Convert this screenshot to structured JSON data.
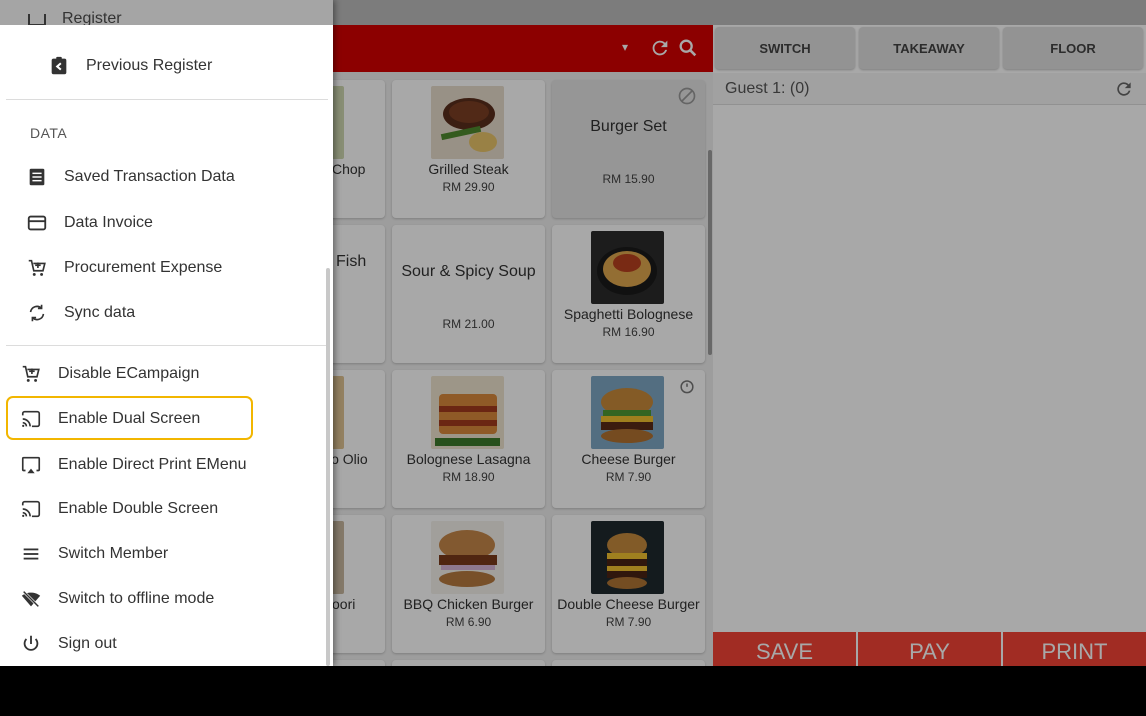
{
  "menu_header": {
    "dropdown_glyph": "▾"
  },
  "products": [
    {
      "name": "Chop",
      "price": "",
      "partial": true
    },
    {
      "name": "Grilled Steak",
      "price": "RM 29.90",
      "image": "steak"
    },
    {
      "name": "Burger Set",
      "price": "RM 15.90",
      "disabled": true
    },
    {
      "name": "Fish",
      "price": "",
      "partial": true
    },
    {
      "name": "Sour & Spicy Soup",
      "price": "RM 21.00"
    },
    {
      "name": "Spaghetti Bolognese",
      "price": "RM 16.90",
      "image": "spaghetti"
    },
    {
      "name": "io Olio",
      "price": "",
      "partial": true
    },
    {
      "name": "Bolognese Lasagna",
      "price": "RM 18.90",
      "image": "lasagna"
    },
    {
      "name": "Cheese Burger",
      "price": "RM 7.90",
      "image": "cheese-burger"
    },
    {
      "name": "oori",
      "price": "",
      "partial": true
    },
    {
      "name": "BBQ Chicken Burger",
      "price": "RM 6.90",
      "image": "bbq-burger"
    },
    {
      "name": "Double Cheese Burger",
      "price": "RM 7.90",
      "image": "double-burger"
    }
  ],
  "order_panel": {
    "modes": [
      "SWITCH",
      "TAKEAWAY",
      "FLOOR"
    ],
    "guest_label": "Guest 1: (0)",
    "actions": [
      "SAVE",
      "PAY",
      "PRINT"
    ]
  },
  "drawer": {
    "cut_off_item": "Register",
    "previous_register": "Previous Register",
    "data_section_title": "DATA",
    "data_items": [
      {
        "label": "Saved Transaction Data",
        "icon": "list-icon"
      },
      {
        "label": "Data Invoice",
        "icon": "card-icon"
      },
      {
        "label": "Procurement Expense",
        "icon": "cart-icon"
      },
      {
        "label": "Sync data",
        "icon": "sync-icon"
      }
    ],
    "settings_items": [
      {
        "label": "Disable ECampaign",
        "icon": "cart-icon"
      },
      {
        "label": "Enable Dual Screen",
        "icon": "cast-icon",
        "highlighted": true
      },
      {
        "label": "Enable Direct Print EMenu",
        "icon": "airplay-icon"
      },
      {
        "label": "Enable Double Screen",
        "icon": "cast-icon"
      },
      {
        "label": "Switch Member",
        "icon": "menu-lines-icon"
      },
      {
        "label": "Switch to offline mode",
        "icon": "wifi-off-icon"
      },
      {
        "label": "Sign out",
        "icon": "power-icon"
      }
    ]
  },
  "colors": {
    "brand_red": "#d50000",
    "action_red": "#f44336",
    "highlight": "#f2b600"
  }
}
